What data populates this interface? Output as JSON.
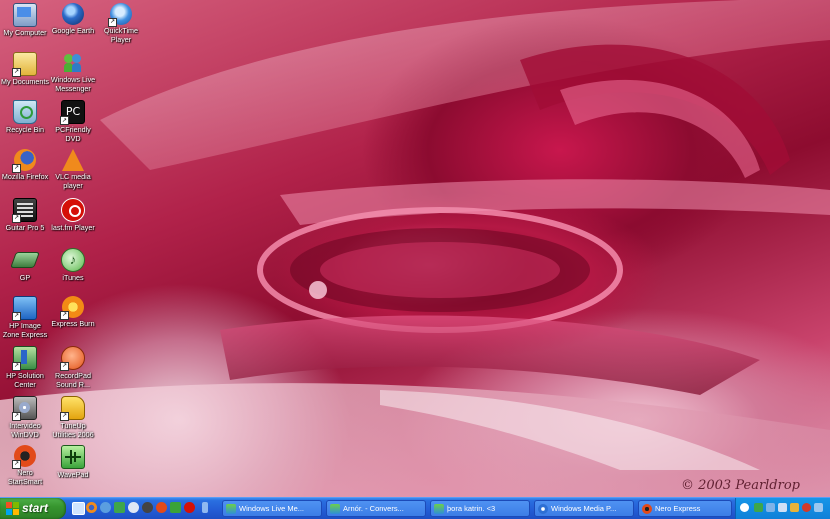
{
  "desktop": {
    "icons": [
      {
        "label": "My Computer",
        "icon": "my-computer-icon"
      },
      {
        "label": "Google Earth",
        "icon": "google-earth-icon"
      },
      {
        "label": "QuickTime Player",
        "icon": "quicktime-icon"
      },
      {
        "label": "My Documents",
        "icon": "my-documents-icon"
      },
      {
        "label": "Windows Live Messenger",
        "icon": "messenger-icon"
      },
      {
        "label": "Recycle Bin",
        "icon": "recycle-bin-icon"
      },
      {
        "label": "PCFriendly DVD",
        "icon": "pcfriendly-dvd-icon"
      },
      {
        "label": "Mozilla Firefox",
        "icon": "firefox-icon"
      },
      {
        "label": "VLC media player",
        "icon": "vlc-icon"
      },
      {
        "label": "Guitar Pro 5",
        "icon": "guitar-pro-icon"
      },
      {
        "label": "last.fm Player",
        "icon": "lastfm-icon"
      },
      {
        "label": "GP",
        "icon": "gp-icon"
      },
      {
        "label": "iTunes",
        "icon": "itunes-icon"
      },
      {
        "label": "HP Image Zone Express",
        "icon": "hp-image-zone-icon"
      },
      {
        "label": "Express Burn",
        "icon": "express-burn-icon"
      },
      {
        "label": "HP Solution Center",
        "icon": "hp-solution-center-icon"
      },
      {
        "label": "RecordPad Sound R...",
        "icon": "recordpad-icon"
      },
      {
        "label": "Intervideo WinDVD",
        "icon": "windvd-icon"
      },
      {
        "label": "TuneUp Utilities 2006",
        "icon": "tuneup-icon"
      },
      {
        "label": "Nero StartSmart",
        "icon": "nero-icon"
      },
      {
        "label": "WavePad",
        "icon": "wavepad-icon"
      }
    ],
    "signature": "© 2003 Pearldrop"
  },
  "taskbar": {
    "start_label": "start",
    "tasks": [
      {
        "label": "Windows Live Me...",
        "icon": "messenger-icon"
      },
      {
        "label": "Arnór. - Convers...",
        "icon": "messenger-icon"
      },
      {
        "label": "þora katrin. <3",
        "icon": "messenger-icon"
      },
      {
        "label": "Windows Media P...",
        "icon": "media-player-icon"
      },
      {
        "label": "Nero Express",
        "icon": "nero-icon"
      }
    ]
  },
  "colors": {
    "taskbar": "#245dd6",
    "start_button": "#37962f",
    "tray": "#0f80d8",
    "wallpaper": "#b1224a"
  }
}
